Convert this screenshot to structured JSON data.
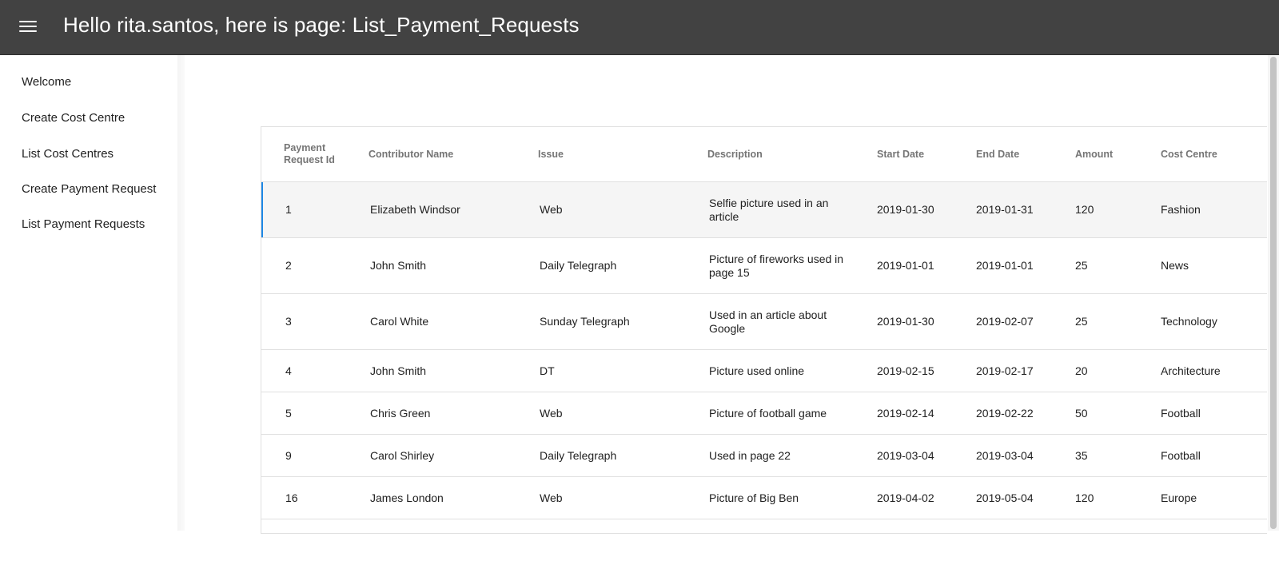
{
  "header": {
    "title": "Hello rita.santos, here is page: List_Payment_Requests",
    "menu_icon": "menu-icon"
  },
  "sidebar": {
    "items": [
      {
        "label": "Welcome"
      },
      {
        "label": "Create Cost Centre"
      },
      {
        "label": "List Cost Centres"
      },
      {
        "label": "Create Payment Request"
      },
      {
        "label": "List Payment Requests"
      }
    ]
  },
  "table": {
    "columns": [
      "Payment Request Id",
      "Contributor Name",
      "Issue",
      "Description",
      "Start Date",
      "End Date",
      "Amount",
      "Cost Centre"
    ],
    "rows": [
      {
        "id": "1",
        "contributor": "Elizabeth Windsor",
        "issue": "Web",
        "description": "Selfie picture used in an article",
        "start": "2019-01-30",
        "end": "2019-01-31",
        "amount": "120",
        "cost_centre": "Fashion"
      },
      {
        "id": "2",
        "contributor": "John Smith",
        "issue": "Daily Telegraph",
        "description": "Picture of fireworks used in page 15",
        "start": "2019-01-01",
        "end": "2019-01-01",
        "amount": "25",
        "cost_centre": "News"
      },
      {
        "id": "3",
        "contributor": "Carol White",
        "issue": "Sunday Telegraph",
        "description": "Used in an article about Google",
        "start": "2019-01-30",
        "end": "2019-02-07",
        "amount": "25",
        "cost_centre": "Technology"
      },
      {
        "id": "4",
        "contributor": "John Smith",
        "issue": "DT",
        "description": "Picture used online",
        "start": "2019-02-15",
        "end": "2019-02-17",
        "amount": "20",
        "cost_centre": "Architecture"
      },
      {
        "id": "5",
        "contributor": "Chris Green",
        "issue": "Web",
        "description": "Picture of football game",
        "start": "2019-02-14",
        "end": "2019-02-22",
        "amount": "50",
        "cost_centre": "Football"
      },
      {
        "id": "9",
        "contributor": "Carol Shirley",
        "issue": "Daily Telegraph",
        "description": "Used in page 22",
        "start": "2019-03-04",
        "end": "2019-03-04",
        "amount": "35",
        "cost_centre": "Football"
      },
      {
        "id": "16",
        "contributor": "James London",
        "issue": "Web",
        "description": "Picture of Big Ben",
        "start": "2019-04-02",
        "end": "2019-05-04",
        "amount": "120",
        "cost_centre": "Europe"
      }
    ]
  },
  "colors": {
    "appbar": "#424242",
    "selected_row": "#f5f5f5",
    "accent": "#1e88e5"
  }
}
